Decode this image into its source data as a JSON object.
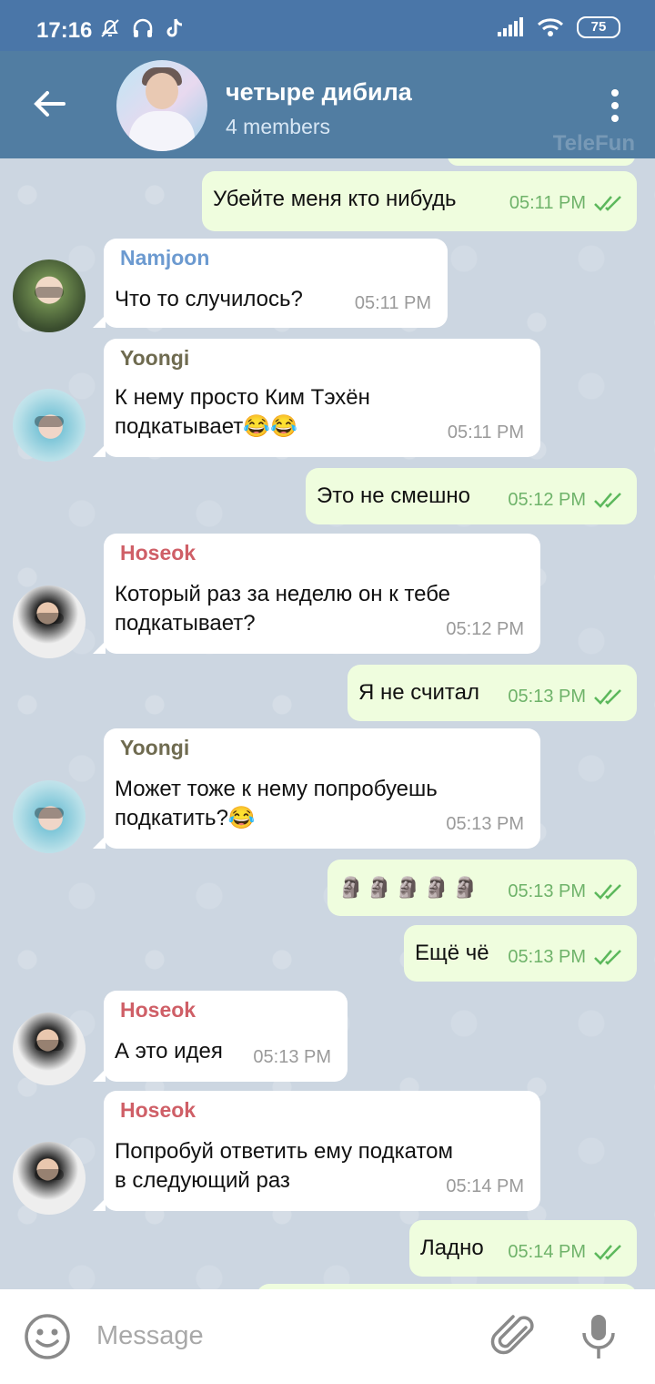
{
  "status": {
    "time": "17:16",
    "battery": "75"
  },
  "header": {
    "title": "четыре дибила",
    "subtitle": "4 members",
    "watermark": "TeleFun"
  },
  "colors": {
    "header": "#517da2",
    "outgoing": "#effdde",
    "incoming": "#ffffff",
    "check": "#5cb85c"
  },
  "messages": [
    {
      "dir": "out",
      "text": "Убейте меня кто нибудь",
      "time": "05:11 PM"
    },
    {
      "dir": "in",
      "sender": "Namjoon",
      "sender_color": "#6c9ad0",
      "text": [
        "Что то случилось?"
      ],
      "time": "05:11 PM"
    },
    {
      "dir": "in",
      "sender": "Yoongi",
      "sender_color": "#6f6b50",
      "text": [
        "К нему просто Ким Тэхён",
        "подкатывает😂😂"
      ],
      "time": "05:11 PM"
    },
    {
      "dir": "out",
      "text": "Это не смешно",
      "time": "05:12 PM"
    },
    {
      "dir": "in",
      "sender": "Hoseok",
      "sender_color": "#cf5f67",
      "text": [
        "Который раз за неделю он к тебе",
        "подкатывает?"
      ],
      "time": "05:12 PM"
    },
    {
      "dir": "out",
      "text": "Я не считал",
      "time": "05:13 PM"
    },
    {
      "dir": "in",
      "sender": "Yoongi",
      "sender_color": "#6f6b50",
      "text": [
        "Может тоже к нему попробуешь",
        "подкатить?😂"
      ],
      "time": "05:13 PM"
    },
    {
      "dir": "out",
      "text": "🗿🗿🗿🗿🗿",
      "time": "05:13 PM"
    },
    {
      "dir": "out",
      "text": "Ещё чё",
      "time": "05:13 PM"
    },
    {
      "dir": "in",
      "sender": "Hoseok",
      "sender_color": "#cf5f67",
      "text": [
        "А это идея"
      ],
      "time": "05:13 PM"
    },
    {
      "dir": "in",
      "sender": "Hoseok",
      "sender_color": "#cf5f67",
      "text": [
        "Попробуй ответить ему подкатом",
        "в следующий раз"
      ],
      "time": "05:14 PM"
    },
    {
      "dir": "out",
      "text": "Ладно",
      "time": "05:14 PM"
    }
  ],
  "input": {
    "placeholder": "Message"
  }
}
